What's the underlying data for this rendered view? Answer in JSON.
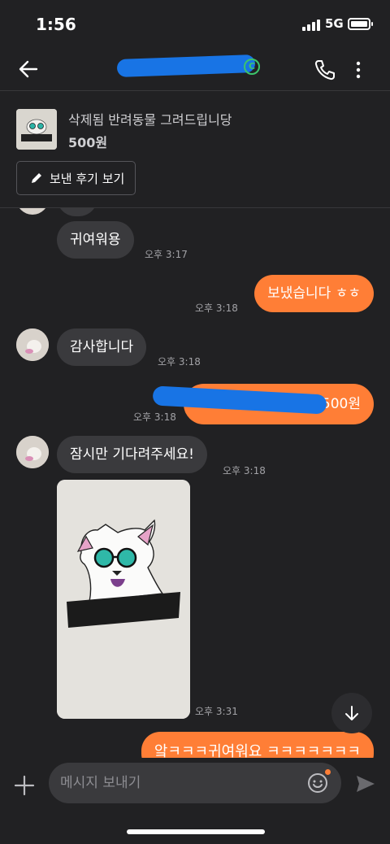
{
  "status_bar": {
    "time": "1:56",
    "network": "5G"
  },
  "header": {
    "temperature_badge": "C"
  },
  "product": {
    "title": "삭제됨 반려동물 그려드립니당",
    "price": "500원",
    "review_button": "보낸 후기 보기"
  },
  "messages": [
    {
      "side": "received",
      "text": "귀여워용",
      "time": "오후 3:17"
    },
    {
      "side": "sent",
      "text": "보냈습니다 ㅎㅎ",
      "time": "오후 3:18"
    },
    {
      "side": "received",
      "text": "감사합니다",
      "time": "오후 3:18"
    },
    {
      "side": "sent",
      "text": "500원",
      "time": "오후 3:18"
    },
    {
      "side": "received",
      "text": "잠시만 기다려주세요!",
      "time": "오후 3:18"
    },
    {
      "side": "received",
      "type": "image",
      "time": "오후 3:31"
    },
    {
      "side": "sent",
      "text": "앜ㅋㅋㅋ귀여워요 ㅋㅋㅋㅋㅋㅋㅋ"
    }
  ],
  "input": {
    "placeholder": "메시지 보내기"
  },
  "colors": {
    "accent": "#ff7e36",
    "background": "#212123",
    "received_bubble": "#3a3a3d",
    "redaction": "#1874e5"
  }
}
